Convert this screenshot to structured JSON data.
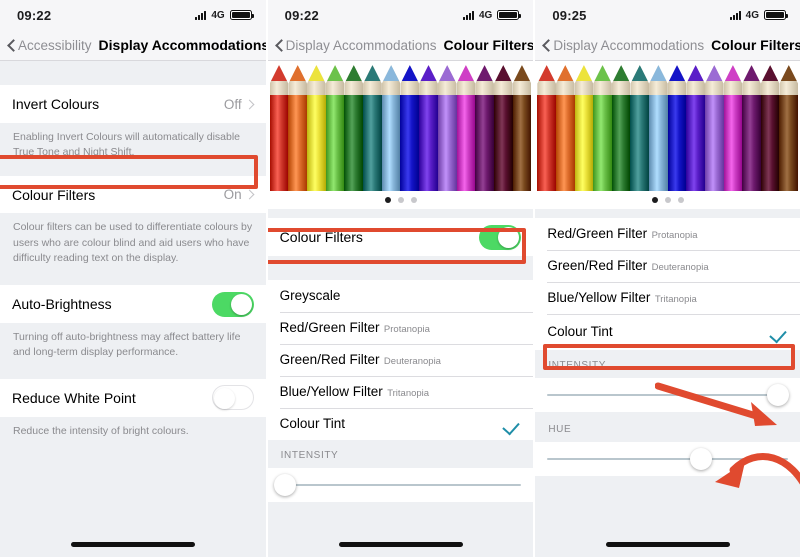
{
  "accent": {
    "toggle_on": "#4CD964",
    "annotation_red": "#E04A2F",
    "link_blue": "#8E8E93",
    "check_teal": "#1F8EA8"
  },
  "pencil_colors": [
    "#d33b2e",
    "#e0702e",
    "#ece33c",
    "#6cc24a",
    "#2e7d32",
    "#2b7a78",
    "#8ab8dc",
    "#1414c8",
    "#5a1ec8",
    "#9b6bd4",
    "#cf3fc6",
    "#6e1a6e",
    "#5a1030",
    "#7a4a1e"
  ],
  "screen1": {
    "status": {
      "time": "09:22",
      "carrier": "4G",
      "signal_icon": "signal-bars-icon",
      "battery_icon": "battery-icon"
    },
    "nav": {
      "back_label": "Accessibility",
      "back_icon": "chevron-left-icon",
      "title": "Display Accommodations"
    },
    "rows": [
      {
        "label": "Invert Colours",
        "value": "Off",
        "accessory": "disclosure-icon"
      }
    ],
    "footnote1": "Enabling Invert Colours will automatically disable True Tone and Night Shift.",
    "colour_filters_row": {
      "label": "Colour Filters",
      "value": "On",
      "accessory": "disclosure-icon"
    },
    "footnote2": "Colour filters can be used to differentiate colours by users who are colour blind and aid users who have difficulty reading text on the display.",
    "auto_brightness": {
      "label": "Auto-Brightness",
      "state": "on"
    },
    "footnote3": "Turning off auto-brightness may affect battery life and long-term display performance.",
    "reduce_white_point": {
      "label": "Reduce White Point",
      "state": "off"
    },
    "footnote4": "Reduce the intensity of bright colours.",
    "annotation": "highlight-colour-filters-row"
  },
  "screen2": {
    "status": {
      "time": "09:22",
      "carrier": "4G",
      "signal_icon": "signal-bars-icon",
      "battery_icon": "battery-icon"
    },
    "nav": {
      "back_label": "Display Accommodations",
      "back_icon": "chevron-left-icon",
      "title": "Colour Filters"
    },
    "preview": {
      "image": "coloured-pencils-preview",
      "page_dots": 3,
      "active_dot": 1
    },
    "toggle_row": {
      "label": "Colour Filters",
      "state": "on"
    },
    "filters": [
      {
        "name": "Greyscale",
        "sub": "",
        "selected": false
      },
      {
        "name": "Red/Green Filter",
        "sub": "Protanopia",
        "selected": false
      },
      {
        "name": "Green/Red Filter",
        "sub": "Deuteranopia",
        "selected": false
      },
      {
        "name": "Blue/Yellow Filter",
        "sub": "Tritanopia",
        "selected": false
      },
      {
        "name": "Colour Tint",
        "sub": "",
        "selected": true
      }
    ],
    "intensity": {
      "label": "INTENSITY",
      "value_pct": 2
    },
    "annotation": "highlight-colour-filters-toggle"
  },
  "screen3": {
    "status": {
      "time": "09:25",
      "carrier": "4G",
      "signal_icon": "signal-bars-icon",
      "battery_icon": "battery-icon"
    },
    "nav": {
      "back_label": "Display Accommodations",
      "back_icon": "chevron-left-icon",
      "title": "Colour Filters"
    },
    "preview": {
      "image": "coloured-pencils-preview",
      "page_dots": 3,
      "active_dot": 1
    },
    "filters": [
      {
        "name": "Red/Green Filter",
        "sub": "Protanopia",
        "selected": false
      },
      {
        "name": "Green/Red Filter",
        "sub": "Deuteranopia",
        "selected": false
      },
      {
        "name": "Blue/Yellow Filter",
        "sub": "Tritanopia",
        "selected": false
      },
      {
        "name": "Colour Tint",
        "sub": "",
        "selected": true
      }
    ],
    "intensity": {
      "label": "INTENSITY",
      "value_pct": 96
    },
    "hue": {
      "label": "HUE",
      "value_pct": 64
    },
    "annotations": [
      "highlight-colour-tint-row",
      "arrow-to-intensity-slider",
      "arrow-to-hue-slider"
    ]
  }
}
